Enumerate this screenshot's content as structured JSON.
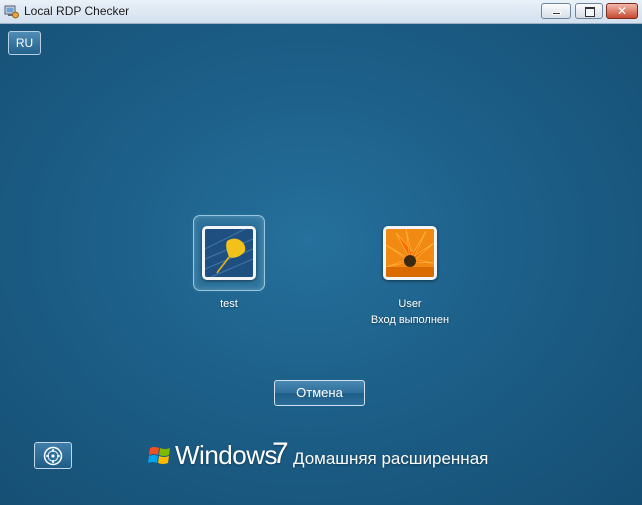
{
  "window": {
    "title": "Local RDP Checker",
    "icon": "remote-desktop-icon",
    "controls": {
      "minimize": "minimize-icon",
      "maximize": "maximize-icon",
      "close_glyph": "✕"
    }
  },
  "toolbar": {
    "language_label": "RU"
  },
  "accounts": [
    {
      "name": "test",
      "status": "",
      "avatar": "ginkgo-leaf-picture",
      "selected": true
    },
    {
      "name": "User",
      "status": "Вход выполнен",
      "avatar": "orange-flower-picture",
      "selected": false
    }
  ],
  "actions": {
    "cancel_label": "Отмена",
    "ease_of_access_icon": "ease-of-access-icon"
  },
  "branding": {
    "product": "Windows",
    "version": "7",
    "edition": "Домашняя расширенная",
    "logo": "windows-flag-icon"
  },
  "colors": {
    "background": "#1d5a82",
    "titlebar": "#dde8f3",
    "close_button": "#c84a31"
  }
}
